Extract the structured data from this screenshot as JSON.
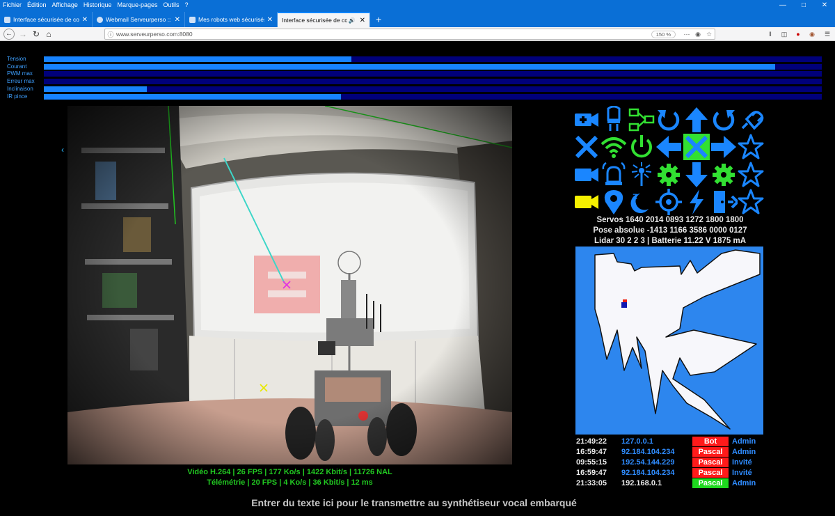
{
  "browser": {
    "menu": [
      "Fichier",
      "Édition",
      "Affichage",
      "Historique",
      "Marque-pages",
      "Outils",
      "?"
    ],
    "tabs": [
      {
        "title": "Interface sécurisée de comman",
        "active": false,
        "speaker": false
      },
      {
        "title": "Webmail Serveurperso :: Boîte",
        "active": false,
        "speaker": false
      },
      {
        "title": "Mes robots web sécurisés avec",
        "active": false,
        "speaker": false
      },
      {
        "title": "Interface sécurisée de comman",
        "active": true,
        "speaker": true
      }
    ],
    "new_tab": "+",
    "url": "www.serveurperso.com:8080",
    "zoom": "150 %"
  },
  "bars": [
    {
      "label": "Tension",
      "level": 0.395
    },
    {
      "label": "Courant",
      "level": 0.94
    },
    {
      "label": "PWM max",
      "level": 0.0
    },
    {
      "label": "Erreur max",
      "level": 0.0
    },
    {
      "label": "Inclinaison",
      "level": 0.132
    },
    {
      "label": "IR pince",
      "level": 0.382
    }
  ],
  "video": {
    "stats": "Vidéo H.264 | 26 FPS | 177 Ko/s | 1422 Kbit/s | 11726 NAL",
    "telemetry": "Télémétrie | 20 FPS | 4 Ko/s | 36 Kbit/s | 12 ms"
  },
  "controls": {
    "icons": [
      {
        "name": "camera-plus-icon",
        "color": "#1a86ff"
      },
      {
        "name": "lightbulb-icon",
        "color": "#1a86ff"
      },
      {
        "name": "network-icon",
        "color": "#32e032"
      },
      {
        "name": "rotate-left-icon",
        "color": "#1a86ff"
      },
      {
        "name": "arrow-up-icon",
        "color": "#1a86ff"
      },
      {
        "name": "rotate-right-icon",
        "color": "#1a86ff"
      },
      {
        "name": "plug-icon",
        "color": "#1a86ff"
      },
      {
        "name": "close-icon",
        "color": "#1a86ff"
      },
      {
        "name": "wifi-icon",
        "color": "#32e032"
      },
      {
        "name": "power-icon",
        "color": "#32e032"
      },
      {
        "name": "arrow-left-icon",
        "color": "#1a86ff"
      },
      {
        "name": "stop-icon",
        "color": "#1a86ff"
      },
      {
        "name": "arrow-right-icon",
        "color": "#1a86ff"
      },
      {
        "name": "star-icon",
        "color": "#1a86ff"
      },
      {
        "name": "camera-icon",
        "color": "#1a86ff"
      },
      {
        "name": "alarm-icon",
        "color": "#1a86ff"
      },
      {
        "name": "laser-icon",
        "color": "#1a86ff"
      },
      {
        "name": "gear-icon",
        "color": "#32e032"
      },
      {
        "name": "arrow-down-icon",
        "color": "#1a86ff"
      },
      {
        "name": "gear-icon",
        "color": "#32e032"
      },
      {
        "name": "star-icon",
        "color": "#1a86ff"
      },
      {
        "name": "camera-active-icon",
        "color": "#f5f000"
      },
      {
        "name": "map-marker-icon",
        "color": "#1a86ff"
      },
      {
        "name": "sleep-icon",
        "color": "#1a86ff"
      },
      {
        "name": "crosshair-icon",
        "color": "#1a86ff"
      },
      {
        "name": "lightning-icon",
        "color": "#1a86ff"
      },
      {
        "name": "exit-door-icon",
        "color": "#1a86ff"
      },
      {
        "name": "star-icon",
        "color": "#1a86ff"
      }
    ]
  },
  "status": {
    "servos": "Servos 1640 2014 0893 1272 1800 1800",
    "pose": "Pose absolue -1413 1166 3586 0000 0127",
    "lidar": "Lidar 30 2 2 3 | Batterie 11.22 V 1875 mA"
  },
  "sessions": [
    {
      "time": "21:49:22",
      "ip": "127.0.0.1",
      "ip_color": "#2f8cff",
      "user": "Bot",
      "user_bg": "#ff1a1a",
      "role": "Admin"
    },
    {
      "time": "16:59:47",
      "ip": "92.184.104.234",
      "ip_color": "#2f8cff",
      "user": "Pascal",
      "user_bg": "#ff1a1a",
      "role": "Admin"
    },
    {
      "time": "09:55:15",
      "ip": "192.54.144.229",
      "ip_color": "#2f8cff",
      "user": "Pascal",
      "user_bg": "#ff1a1a",
      "role": "Invité"
    },
    {
      "time": "16:59:47",
      "ip": "92.184.104.234",
      "ip_color": "#2f8cff",
      "user": "Pascal",
      "user_bg": "#ff1a1a",
      "role": "Invité"
    },
    {
      "time": "21:33:05",
      "ip": "192.168.0.1",
      "ip_color": "#eaeaea",
      "user": "Pascal",
      "user_bg": "#1ed81e",
      "role": "Admin"
    }
  ],
  "tts_prompt": "Entrer du texte ici pour le transmettre au synthétiseur vocal embarqué"
}
